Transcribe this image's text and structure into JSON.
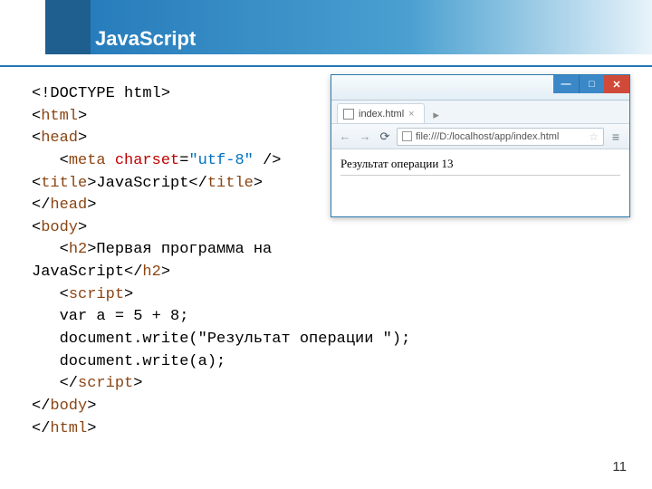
{
  "slide": {
    "title": "JavaScript",
    "page_number": "11"
  },
  "code": {
    "l1_doctype": "<!DOCTYPE html>",
    "l2_open": "<",
    "l2_tag": "html",
    "l2_close": ">",
    "l3_open": "<",
    "l3_tag": "head",
    "l3_close": ">",
    "l4_indent": "   <",
    "l4_tag": "meta",
    "l4_sp": " ",
    "l4_attr": "charset",
    "l4_eq": "=",
    "l4_val": "\"utf-8\"",
    "l4_end": " />",
    "l5_open": "<",
    "l5_tag": "title",
    "l5_mid": ">JavaScript</",
    "l5_tag2": "title",
    "l5_close": ">",
    "l6_open": "</",
    "l6_tag": "head",
    "l6_close": ">",
    "l7_open": "<",
    "l7_tag": "body",
    "l7_close": ">",
    "l8_indent": "   <",
    "l8_tag": "h2",
    "l8_mid": ">Первая программа на",
    "l9_text": "JavaScript</",
    "l9_tag": "h2",
    "l9_close": ">",
    "l10_indent": "   <",
    "l10_tag": "script",
    "l10_close": ">",
    "l11": "   var a = 5 + 8;",
    "l12": "   document.write(\"Результат операции \");",
    "l13": "   document.write(a);",
    "l14_indent": "   </",
    "l14_tag": "script",
    "l14_close": ">",
    "l15_open": "</",
    "l15_tag": "body",
    "l15_close": ">",
    "l16_open": "</",
    "l16_tag": "html",
    "l16_close": ">"
  },
  "browser": {
    "tab_label": "index.html",
    "url": "file:///D:/localhost/app/index.html",
    "page_output": "Результат операции 13",
    "nav_back": "←",
    "nav_fwd": "→",
    "nav_reload": "⟳",
    "star": "☆",
    "menu": "≡",
    "tab_close": "×",
    "tab_new": "▸",
    "min": "—",
    "max": "□",
    "close": "✕"
  }
}
